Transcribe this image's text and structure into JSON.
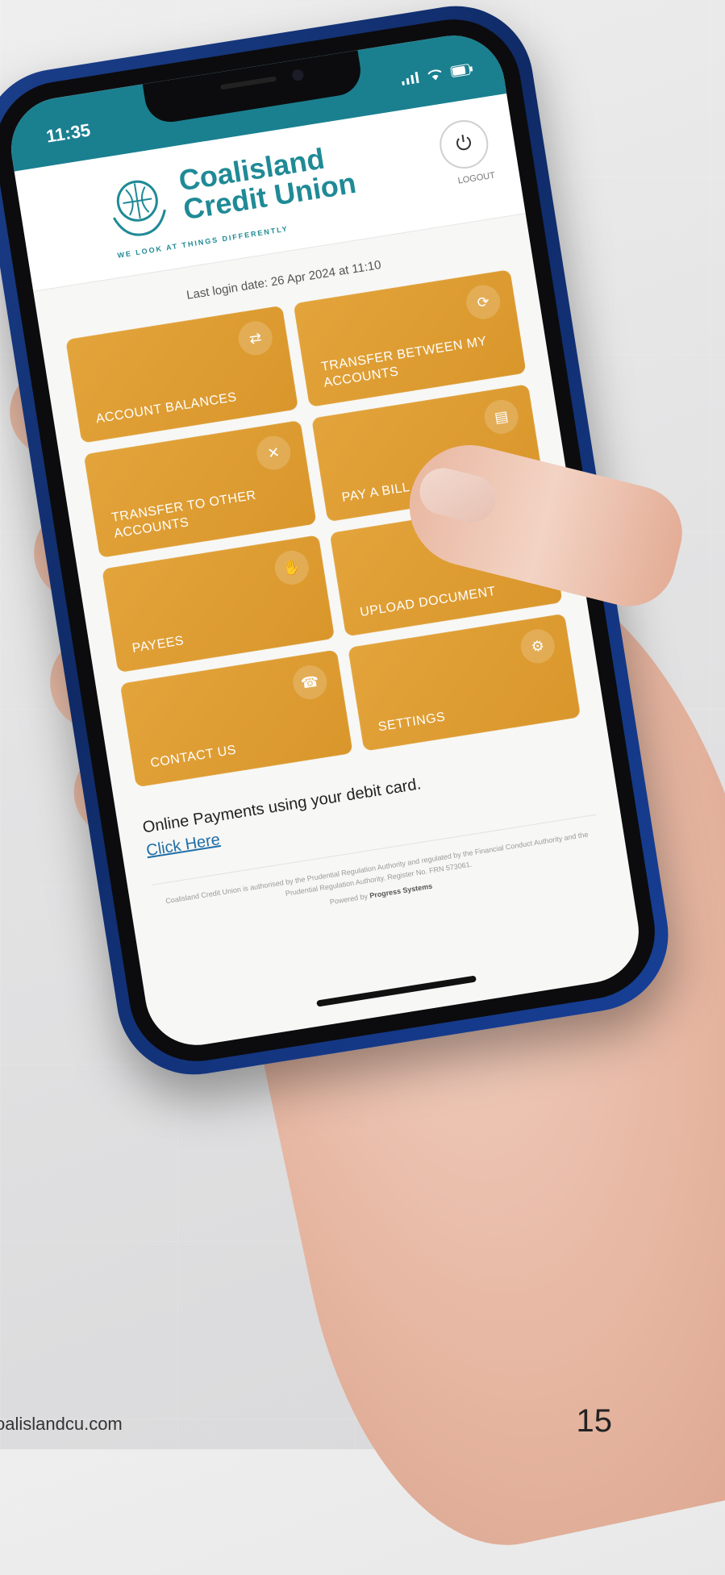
{
  "status_bar": {
    "time": "11:35"
  },
  "brand": {
    "name_line1": "Coalisland",
    "name_line2": "Credit Union",
    "tagline": "WE LOOK AT THINGS DIFFERENTLY"
  },
  "header": {
    "logout_label": "LOGOUT"
  },
  "last_login": "Last login date: 26 Apr 2024 at 11:10",
  "tiles": [
    {
      "label": "ACCOUNT BALANCES",
      "icon": "swap-icon"
    },
    {
      "label": "TRANSFER BETWEEN MY ACCOUNTS",
      "icon": "refresh-icon"
    },
    {
      "label": "TRANSFER TO OTHER ACCOUNTS",
      "icon": "cross-arrows-icon"
    },
    {
      "label": "PAY A BILL",
      "icon": "bill-icon"
    },
    {
      "label": "PAYEES",
      "icon": "hand-coin-icon"
    },
    {
      "label": "UPLOAD DOCUMENT",
      "icon": "upload-icon"
    },
    {
      "label": "CONTACT US",
      "icon": "phone-icon"
    },
    {
      "label": "SETTINGS",
      "icon": "gear-icon"
    }
  ],
  "online_payments": {
    "text": "Online Payments using your debit card.",
    "link": "Click Here"
  },
  "footer": {
    "regulatory": "Coalisland Credit Union is authorised by the Prudential Regulation Authority and regulated by the Financial Conduct Authority and the Prudential Regulation Authority. Register No. FRN 573061.",
    "powered_prefix": "Powered by",
    "powered_name": "Progress Systems"
  },
  "page": {
    "url": "oalislandcu.com",
    "number": "15"
  },
  "colors": {
    "accent": "#1f8a96",
    "tile": "#df9f35",
    "status_bar": "#1a8090",
    "phone_frame": "#1b3f8c"
  }
}
